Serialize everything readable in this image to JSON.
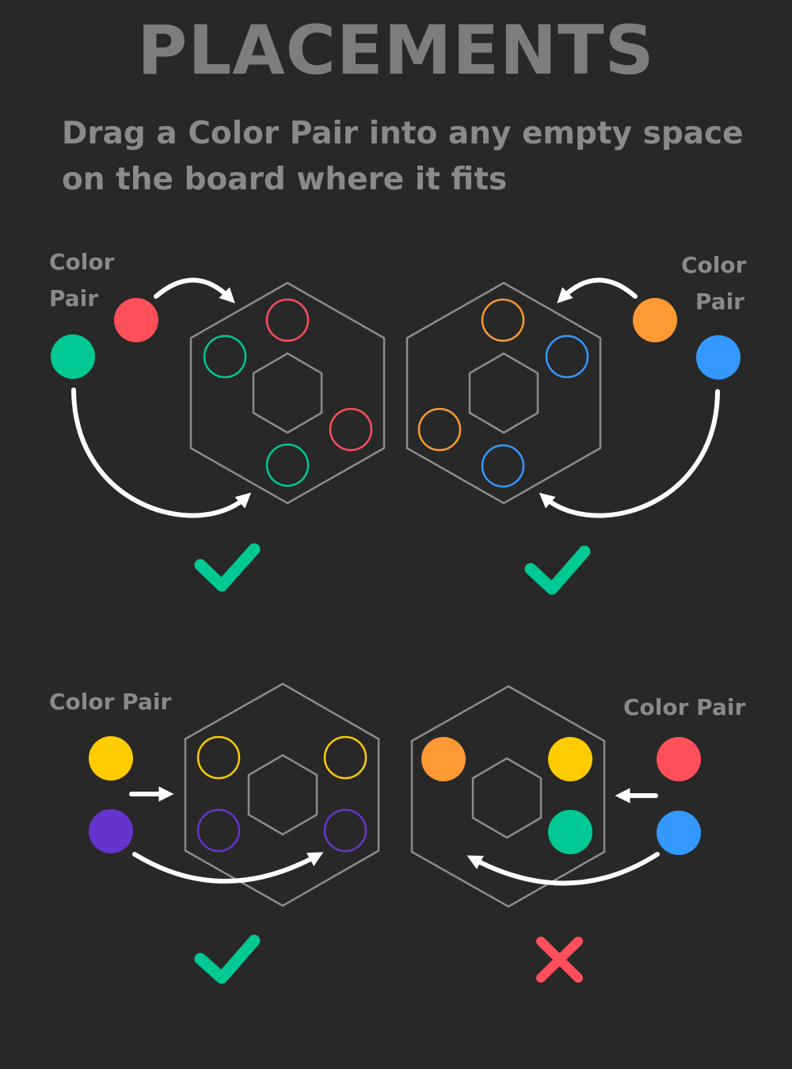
{
  "title": "PLACEMENTS",
  "subtitle": "Drag a Color Pair into any empty space on the board where it fits",
  "colors": {
    "background": "#282828",
    "text": "#8a8a8a",
    "hex_stroke": "#8c8c8c",
    "arrow": "#ffffff",
    "red": "#ff4f5a",
    "green": "#00c993",
    "orange": "#ff9933",
    "blue": "#3399ff",
    "yellow": "#ffcc00",
    "purple": "#6633cc",
    "check": "#00c993",
    "cross": "#ff4f5a"
  },
  "examples": [
    {
      "label_lines": [
        "Color",
        "Pair"
      ],
      "pair_colors": [
        "red",
        "green"
      ],
      "board_slots": [
        {
          "color": "red",
          "filled": false
        },
        {
          "color": "green",
          "filled": false
        },
        {
          "color": "red",
          "filled": false
        },
        {
          "color": "green",
          "filled": false
        }
      ],
      "result": "valid",
      "result_icon": "check-icon"
    },
    {
      "label_lines": [
        "Color",
        "Pair"
      ],
      "pair_colors": [
        "orange",
        "blue"
      ],
      "board_slots": [
        {
          "color": "orange",
          "filled": false
        },
        {
          "color": "blue",
          "filled": false
        },
        {
          "color": "orange",
          "filled": false
        },
        {
          "color": "blue",
          "filled": false
        }
      ],
      "result": "valid",
      "result_icon": "check-icon"
    },
    {
      "label_lines": [
        "Color Pair"
      ],
      "pair_colors": [
        "yellow",
        "purple"
      ],
      "board_slots": [
        {
          "color": "yellow",
          "filled": false
        },
        {
          "color": "yellow",
          "filled": false
        },
        {
          "color": "purple",
          "filled": false
        },
        {
          "color": "purple",
          "filled": false
        }
      ],
      "result": "valid",
      "result_icon": "check-icon"
    },
    {
      "label_lines": [
        "Color Pair"
      ],
      "pair_colors": [
        "red",
        "blue"
      ],
      "board_slots": [
        {
          "color": "orange",
          "filled": true
        },
        {
          "color": "yellow",
          "filled": true
        },
        {
          "color": "green",
          "filled": true
        }
      ],
      "result": "invalid",
      "result_icon": "cross-icon"
    }
  ]
}
